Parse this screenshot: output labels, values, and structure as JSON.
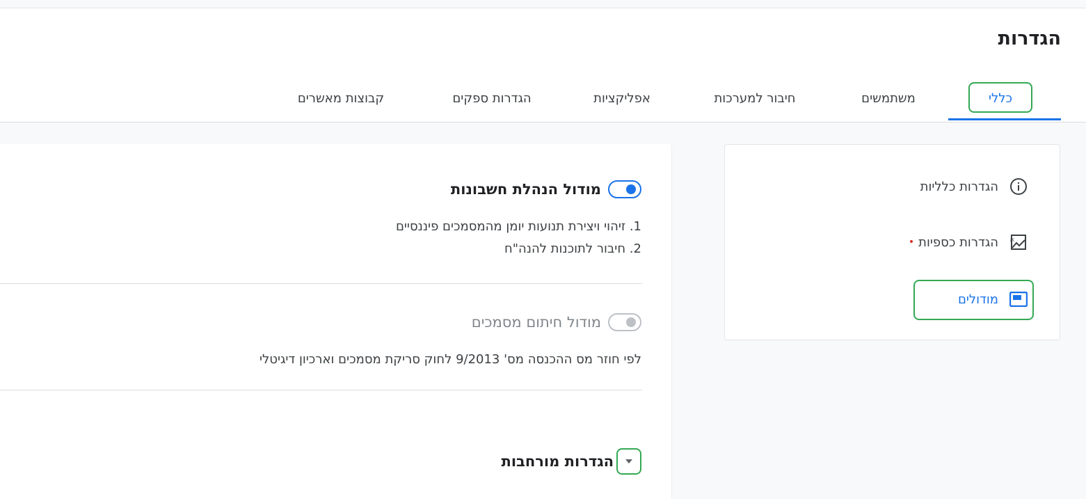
{
  "page": {
    "title": "הגדרות"
  },
  "tabs": [
    {
      "label": "כללי",
      "active": true
    },
    {
      "label": "משתמשים"
    },
    {
      "label": "חיבור למערכות"
    },
    {
      "label": "אפליקציות"
    },
    {
      "label": "הגדרות ספקים"
    },
    {
      "label": "קבוצות מאשרים"
    }
  ],
  "sidebar": {
    "items": [
      {
        "label": "הגדרות כלליות",
        "icon": "info-icon"
      },
      {
        "label": "הגדרות כספיות",
        "icon": "money-icon",
        "required": "•"
      },
      {
        "label": "מודולים",
        "icon": "module-icon",
        "active": true
      }
    ]
  },
  "modules": {
    "accounting": {
      "title": "מודול הנהלת חשבונות",
      "enabled": true,
      "lines": [
        "1. זיהוי ויצירת תנועות יומן מהמסמכים פיננסיים",
        "2. חיבור לתוכנות להנה\"ח"
      ]
    },
    "signing": {
      "title": "מודול חיתום מסמכים",
      "enabled": false,
      "lines": [
        "לפי חוזר מס ההכנסה מס' 9/2013 לחוק סריקת מסמכים וארכיון דיגיטלי"
      ]
    }
  },
  "advanced": {
    "label": "הגדרות מורחבות"
  },
  "colors": {
    "accent": "#1a73e8",
    "highlight": "#34a853",
    "required": "#d93025"
  }
}
